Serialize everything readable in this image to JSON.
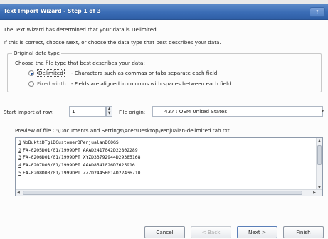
{
  "window": {
    "title": "Text Import Wizard - Step 1 of 3",
    "help_label": "?"
  },
  "intro": {
    "line1": "The Text Wizard has determined that your data is Delimited.",
    "line2": "If this is correct, choose Next, or choose the data type that best describes your data."
  },
  "original_type": {
    "legend": "Original data type",
    "prompt": "Choose the file type that best describes your data:",
    "options": [
      {
        "label": "Delimited",
        "desc": "- Characters such as commas or tabs separate each field.",
        "selected": true
      },
      {
        "label": "Fixed width",
        "desc": "- Fields are aligned in columns with spaces between each field.",
        "selected": false
      }
    ]
  },
  "start_row": {
    "label": "Start import at row:",
    "value": "1"
  },
  "file_origin": {
    "label": "File origin:",
    "value": "437 : OEM United States"
  },
  "preview": {
    "label": "Preview of file C:\\Documents and Settings\\Acer\\Desktop\\Penjualan-delimited tab.txt.",
    "rows": [
      {
        "num": "1",
        "text": "NoBuktiDTglDCustomerDPenjualanDCOGS"
      },
      {
        "num": "2",
        "text": "FA-0205D01/01/1999DPT AAAD2417042D22802289"
      },
      {
        "num": "3",
        "text": "FA-0206D01/01/1999DPT XYZD33792944D29385168"
      },
      {
        "num": "4",
        "text": "FA-0207D03/01/1999DPT AAAD8541026D7625916"
      },
      {
        "num": "5",
        "text": "FA-0208D03/01/1999DPT ZZZD24456014D22436710"
      }
    ]
  },
  "buttons": {
    "cancel": "Cancel",
    "back": "< Back",
    "next": "Next >",
    "finish": "Finish"
  }
}
